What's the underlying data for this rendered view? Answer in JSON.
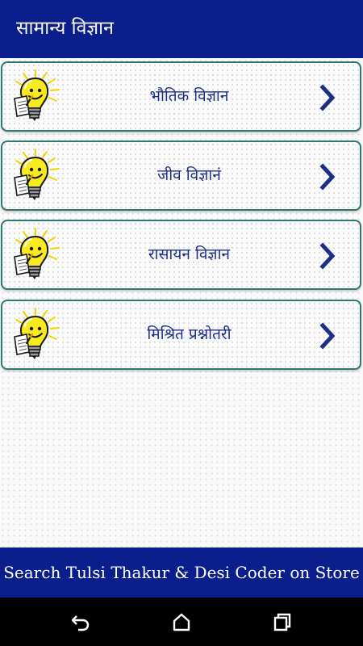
{
  "app_bar": {
    "title": "सामान्य विज्ञान"
  },
  "menu": {
    "items": [
      {
        "label": "भौतिक विज्ञान"
      },
      {
        "label": "जीव विज्ञानं"
      },
      {
        "label": "रासायन विज्ञान"
      },
      {
        "label": "मिश्रित प्रश्नोतरी"
      }
    ]
  },
  "banner": {
    "text": "Search Tulsi Thakur & Desi Coder on Store"
  },
  "colors": {
    "primary": "#0b1f8c",
    "label": "#1c2f86",
    "card_border": "#2e7a6e",
    "bulb": "#f7ea1e"
  },
  "nav": {
    "icons": [
      "back-icon",
      "home-icon",
      "recents-icon"
    ]
  }
}
